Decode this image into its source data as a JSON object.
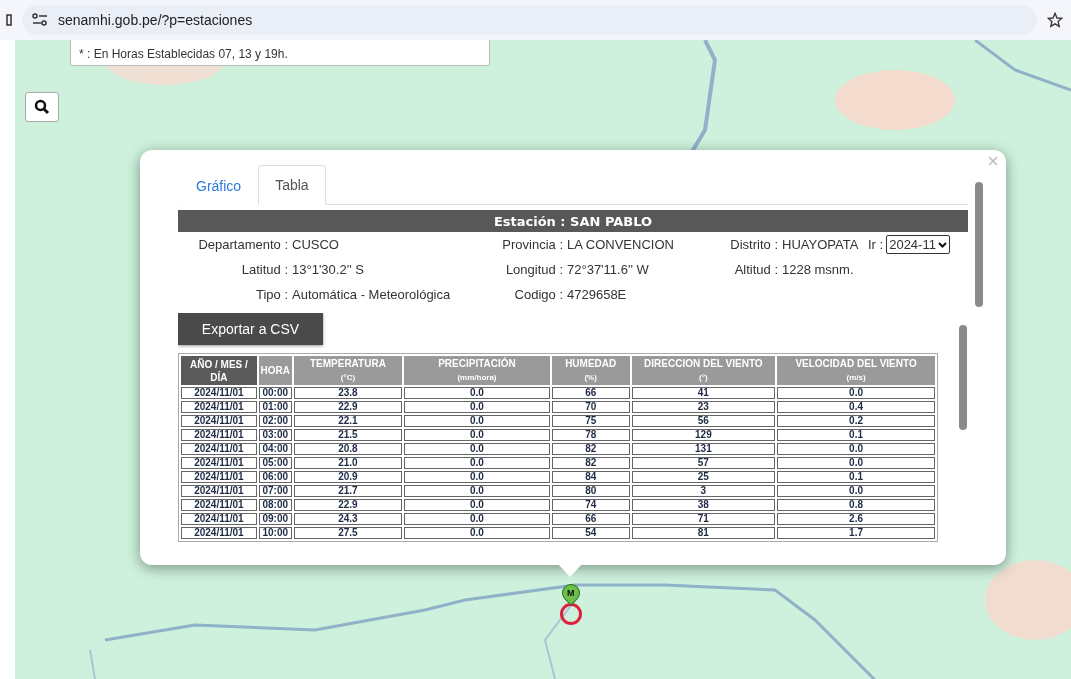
{
  "browser": {
    "url": "senamhi.gob.pe/?p=estaciones"
  },
  "map": {
    "kind": "picture",
    "note": "* : En Horas Establecidas 07, 13 y 19h.",
    "marker_label": "M"
  },
  "popup": {
    "tabs": [
      {
        "label": "Gráfico",
        "selected": false
      },
      {
        "label": "Tabla",
        "selected": true
      }
    ],
    "station": "Estación : SAN PABLO",
    "info": [
      [
        {
          "label": "Departamento :",
          "value": "CUSCO"
        },
        {
          "label": "Provincia :",
          "value": "LA CONVENCION"
        },
        {
          "label": "Distrito :",
          "value": "HUAYOPATA"
        }
      ],
      [
        {
          "label": "Latitud :",
          "value": "13°1'30.2'' S"
        },
        {
          "label": "Longitud :",
          "value": "72°37'11.6'' W"
        },
        {
          "label": "Altitud :",
          "value": "1228 msnm."
        }
      ],
      [
        {
          "label": "Tipo :",
          "value": "Automática - Meteorológica"
        },
        {
          "label": "Codigo :",
          "value": "4729658E"
        }
      ]
    ],
    "period": {
      "label": "Ir :",
      "value": "2024-11"
    },
    "export_button": "Exportar a CSV",
    "table": {
      "columns": [
        {
          "title": "AÑO / MES / DÍA"
        },
        {
          "title": "HORA"
        },
        {
          "title": "TEMPERATURA",
          "unit": "(°C)"
        },
        {
          "title": "PRECIPITACIÓN",
          "unit": "(mm/hora)"
        },
        {
          "title": "HUMEDAD",
          "unit": "(%)"
        },
        {
          "title": "DIRECCION DEL VIENTO",
          "unit": "(°)"
        },
        {
          "title": "VELOCIDAD DEL VIENTO",
          "unit": "(m/s)"
        }
      ],
      "rows": [
        [
          "2024/11/01",
          "00:00",
          "23.8",
          "0.0",
          "66",
          "41",
          "0.0"
        ],
        [
          "2024/11/01",
          "01:00",
          "22.9",
          "0.0",
          "70",
          "23",
          "0.4"
        ],
        [
          "2024/11/01",
          "02:00",
          "22.1",
          "0.0",
          "75",
          "56",
          "0.2"
        ],
        [
          "2024/11/01",
          "03:00",
          "21.5",
          "0.0",
          "78",
          "129",
          "0.1"
        ],
        [
          "2024/11/01",
          "04:00",
          "20.8",
          "0.0",
          "82",
          "131",
          "0.0"
        ],
        [
          "2024/11/01",
          "05:00",
          "21.0",
          "0.0",
          "82",
          "57",
          "0.0"
        ],
        [
          "2024/11/01",
          "06:00",
          "20.9",
          "0.0",
          "84",
          "25",
          "0.1"
        ],
        [
          "2024/11/01",
          "07:00",
          "21.7",
          "0.0",
          "80",
          "3",
          "0.0"
        ],
        [
          "2024/11/01",
          "08:00",
          "22.9",
          "0.0",
          "74",
          "38",
          "0.8"
        ],
        [
          "2024/11/01",
          "09:00",
          "24.3",
          "0.0",
          "66",
          "71",
          "2.6"
        ],
        [
          "2024/11/01",
          "10:00",
          "27.5",
          "0.0",
          "54",
          "81",
          "1.7"
        ]
      ]
    }
  }
}
